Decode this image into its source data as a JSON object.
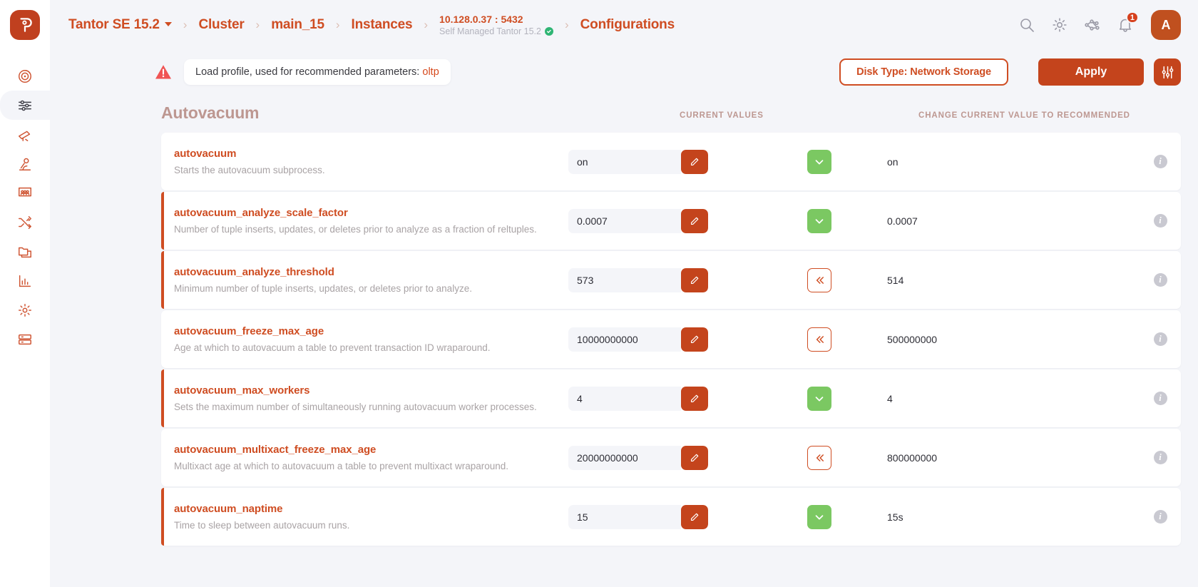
{
  "theme": {
    "accent": "#cf4d22",
    "accent_button": "#c4441c",
    "accent_green": "#7bc862",
    "muted_title": "#bd9791",
    "page_bg": "#f4f5f9"
  },
  "sidebar": {
    "logo_name": "tantor-logo",
    "items": [
      {
        "name": "sidebar-item-dashboard",
        "icon": "radar-target-icon",
        "active": false
      },
      {
        "name": "sidebar-item-configurations",
        "icon": "sliders-icon",
        "active": true
      },
      {
        "name": "sidebar-item-monitoring",
        "icon": "telescope-icon",
        "active": false
      },
      {
        "name": "sidebar-item-diagnostics",
        "icon": "microscope-icon",
        "active": false
      },
      {
        "name": "sidebar-item-sessions",
        "icon": "users-board-icon",
        "active": false
      },
      {
        "name": "sidebar-item-tasks",
        "icon": "shuffle-icon",
        "active": false
      },
      {
        "name": "sidebar-item-files",
        "icon": "folders-icon",
        "active": false
      },
      {
        "name": "sidebar-item-reports",
        "icon": "bar-chart-icon",
        "active": false
      },
      {
        "name": "sidebar-item-settings",
        "icon": "gear-icon",
        "active": false
      },
      {
        "name": "sidebar-item-databases",
        "icon": "database-icon",
        "active": false
      }
    ]
  },
  "topbar": {
    "breadcrumb": [
      {
        "label": "Tantor SE 15.2",
        "has_caret": true
      },
      {
        "label": "Cluster",
        "has_caret": false
      },
      {
        "label": "main_15",
        "has_caret": false
      },
      {
        "label": "Instances",
        "has_caret": false
      }
    ],
    "separator": "›",
    "host": {
      "address": "10.128.0.37 : 5432",
      "subtitle": "Self Managed Tantor 15.2",
      "status_icon": "check-circle-icon"
    },
    "current_page": "Configurations",
    "actions": {
      "search_icon": "search-icon",
      "settings_icon": "gear-icon",
      "topology_icon": "network-graph-icon",
      "notifications_icon": "bell-icon",
      "notifications_count": "1",
      "avatar_initial": "A"
    }
  },
  "action_bar": {
    "warning_icon": "warning-triangle-icon",
    "warning_text": "Load profile, used for recommended parameters:",
    "warning_value": "oltp",
    "disk_type_label": "Disk Type: Network Storage",
    "apply_label": "Apply",
    "filter_icon": "sliders-filter-icon"
  },
  "section": {
    "title": "Autovacuum",
    "col_current": "CURRENT VALUES",
    "col_recommended": "CHANGE CURRENT VALUE TO RECOMMENDED"
  },
  "rows": [
    {
      "name": "autovacuum",
      "description": "Starts the autovacuum subprocess.",
      "current_value": "on",
      "recommended_value": "on",
      "apply_state": "ok",
      "flagged": false,
      "edit_icon": "pencil-icon",
      "apply_icon": "chevron-down-icon",
      "help_icon": "info-icon"
    },
    {
      "name": "autovacuum_analyze_scale_factor",
      "description": "Number of tuple inserts, updates, or deletes prior to analyze as a fraction of reltuples.",
      "current_value": "0.0007",
      "recommended_value": "0.0007",
      "apply_state": "ok",
      "flagged": true,
      "edit_icon": "pencil-icon",
      "apply_icon": "chevron-down-icon",
      "help_icon": "info-icon"
    },
    {
      "name": "autovacuum_analyze_threshold",
      "description": "Minimum number of tuple inserts, updates, or deletes prior to analyze.",
      "current_value": "573",
      "recommended_value": "514",
      "apply_state": "revert",
      "flagged": true,
      "edit_icon": "pencil-icon",
      "apply_icon": "double-chevron-left-icon",
      "help_icon": "info-icon"
    },
    {
      "name": "autovacuum_freeze_max_age",
      "description": "Age at which to autovacuum a table to prevent transaction ID wraparound.",
      "current_value": "10000000000",
      "recommended_value": "500000000",
      "apply_state": "revert",
      "flagged": false,
      "edit_icon": "pencil-icon",
      "apply_icon": "double-chevron-left-icon",
      "help_icon": "info-icon"
    },
    {
      "name": "autovacuum_max_workers",
      "description": "Sets the maximum number of simultaneously running autovacuum worker processes.",
      "current_value": "4",
      "recommended_value": "4",
      "apply_state": "ok",
      "flagged": true,
      "edit_icon": "pencil-icon",
      "apply_icon": "chevron-down-icon",
      "help_icon": "info-icon"
    },
    {
      "name": "autovacuum_multixact_freeze_max_age",
      "description": "Multixact age at which to autovacuum a table to prevent multixact wraparound.",
      "current_value": "20000000000",
      "recommended_value": "800000000",
      "apply_state": "revert",
      "flagged": false,
      "edit_icon": "pencil-icon",
      "apply_icon": "double-chevron-left-icon",
      "help_icon": "info-icon"
    },
    {
      "name": "autovacuum_naptime",
      "description": "Time to sleep between autovacuum runs.",
      "current_value": "15",
      "recommended_value": "15s",
      "apply_state": "ok",
      "flagged": true,
      "edit_icon": "pencil-icon",
      "apply_icon": "chevron-down-icon",
      "help_icon": "info-icon"
    }
  ]
}
